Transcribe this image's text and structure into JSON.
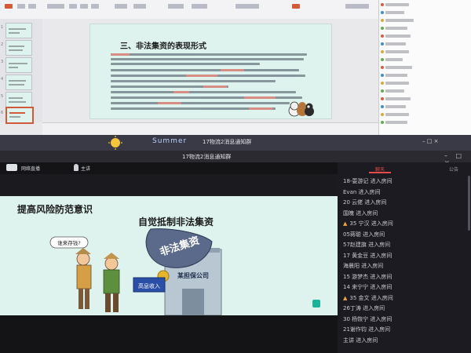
{
  "editor": {
    "slide_title": "三、非法集资的表现形式",
    "thumbnails": [
      "1",
      "2",
      "3",
      "4",
      "5",
      "6"
    ]
  },
  "taskbar": {
    "summer_label": "Summer",
    "center_text": "17物流2消息通知群",
    "right_text": "– □ ×"
  },
  "player": {
    "title": "17物流2消息通知群",
    "controls": "– □ ×",
    "brand": "网络直播",
    "host_label": "主讲"
  },
  "slide2": {
    "line1": "提高风险防范意识",
    "line2": "自觉抵制非法集资",
    "speech_bubble": "谁来存钱?",
    "sack_text": "非法集资",
    "box_text": "高息收入",
    "building_sign": "某担保公司"
  },
  "chat": {
    "tab_active": "聊天",
    "tab_other": "公告",
    "messages": [
      {
        "text": "18-耍游记 进入房间",
        "warn": false
      },
      {
        "text": "Evan 进入房间",
        "warn": false
      },
      {
        "text": "20  云佬 进入房间",
        "warn": false
      },
      {
        "text": "国魄 进入房间",
        "warn": false
      },
      {
        "text": "35 宁汉 进入房间",
        "warn": true
      },
      {
        "text": "05蒋聪 进入房间",
        "warn": false
      },
      {
        "text": "57赵建旗 进入房间",
        "warn": false
      },
      {
        "text": "17 黄金豆 进入房间",
        "warn": false
      },
      {
        "text": "海晨阳 进入房间",
        "warn": false
      },
      {
        "text": "15 游梦杰 进入房间",
        "warn": false
      },
      {
        "text": "14 来宁宁 进入房间",
        "warn": false
      },
      {
        "text": "35 金文 进入房间",
        "warn": true
      },
      {
        "text": "26丁涛 进入房间",
        "warn": false
      },
      {
        "text": "30 杨恢宁 进入房间",
        "warn": false
      },
      {
        "text": "21谢作钧 进入房间",
        "warn": false
      },
      {
        "text": "主讲 进入房间",
        "warn": false
      }
    ]
  },
  "colors": {
    "slide_bg": "#dff3ee",
    "accent_red": "#e64a4a",
    "dark_bg": "#1c1b21"
  }
}
